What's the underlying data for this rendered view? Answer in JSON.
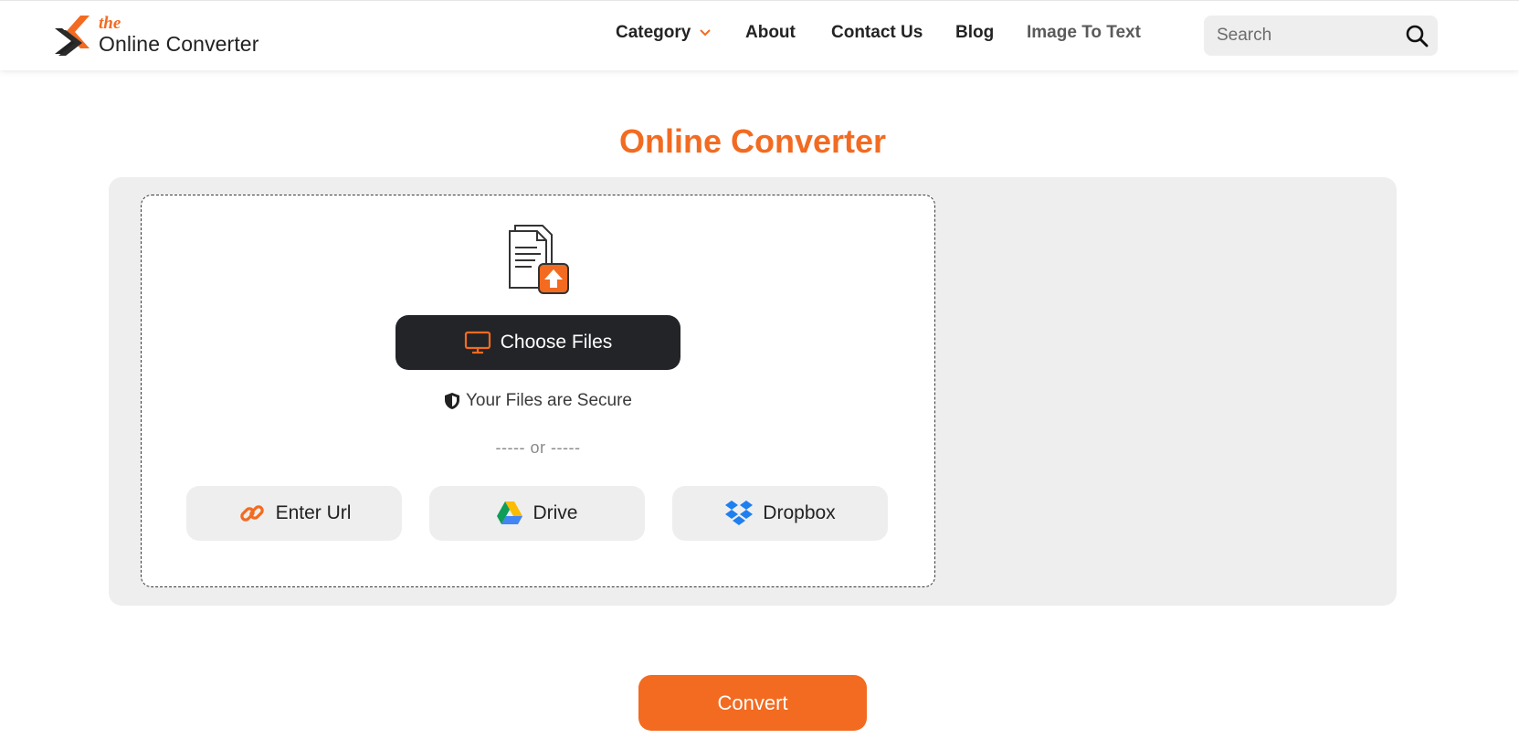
{
  "brand": {
    "the": "the",
    "name": "Online Converter",
    "accent_color": "#f26b21"
  },
  "nav": {
    "items": [
      {
        "label": "Category",
        "has_dropdown": true,
        "icon": "chevron-down-icon"
      },
      {
        "label": "About"
      },
      {
        "label": "Contact Us"
      },
      {
        "label": "Blog"
      },
      {
        "label": "Image To Text"
      }
    ]
  },
  "search": {
    "placeholder": "Search",
    "value": "",
    "icon": "search-icon"
  },
  "main": {
    "title": "Online Converter",
    "upload": {
      "icon": "file-upload-icon",
      "choose_label": "Choose Files",
      "choose_icon": "monitor-icon",
      "secure_text": "Your Files are Secure",
      "secure_icon": "shield-icon",
      "or_text": "----- or -----",
      "sources": [
        {
          "label": "Enter Url",
          "icon": "link-icon"
        },
        {
          "label": "Drive",
          "icon": "google-drive-icon"
        },
        {
          "label": "Dropbox",
          "icon": "dropbox-icon"
        }
      ]
    },
    "convert_label": "Convert"
  },
  "colors": {
    "accent": "#f26b21",
    "dark_button": "#222427",
    "panel_bg": "#eeeeee"
  }
}
